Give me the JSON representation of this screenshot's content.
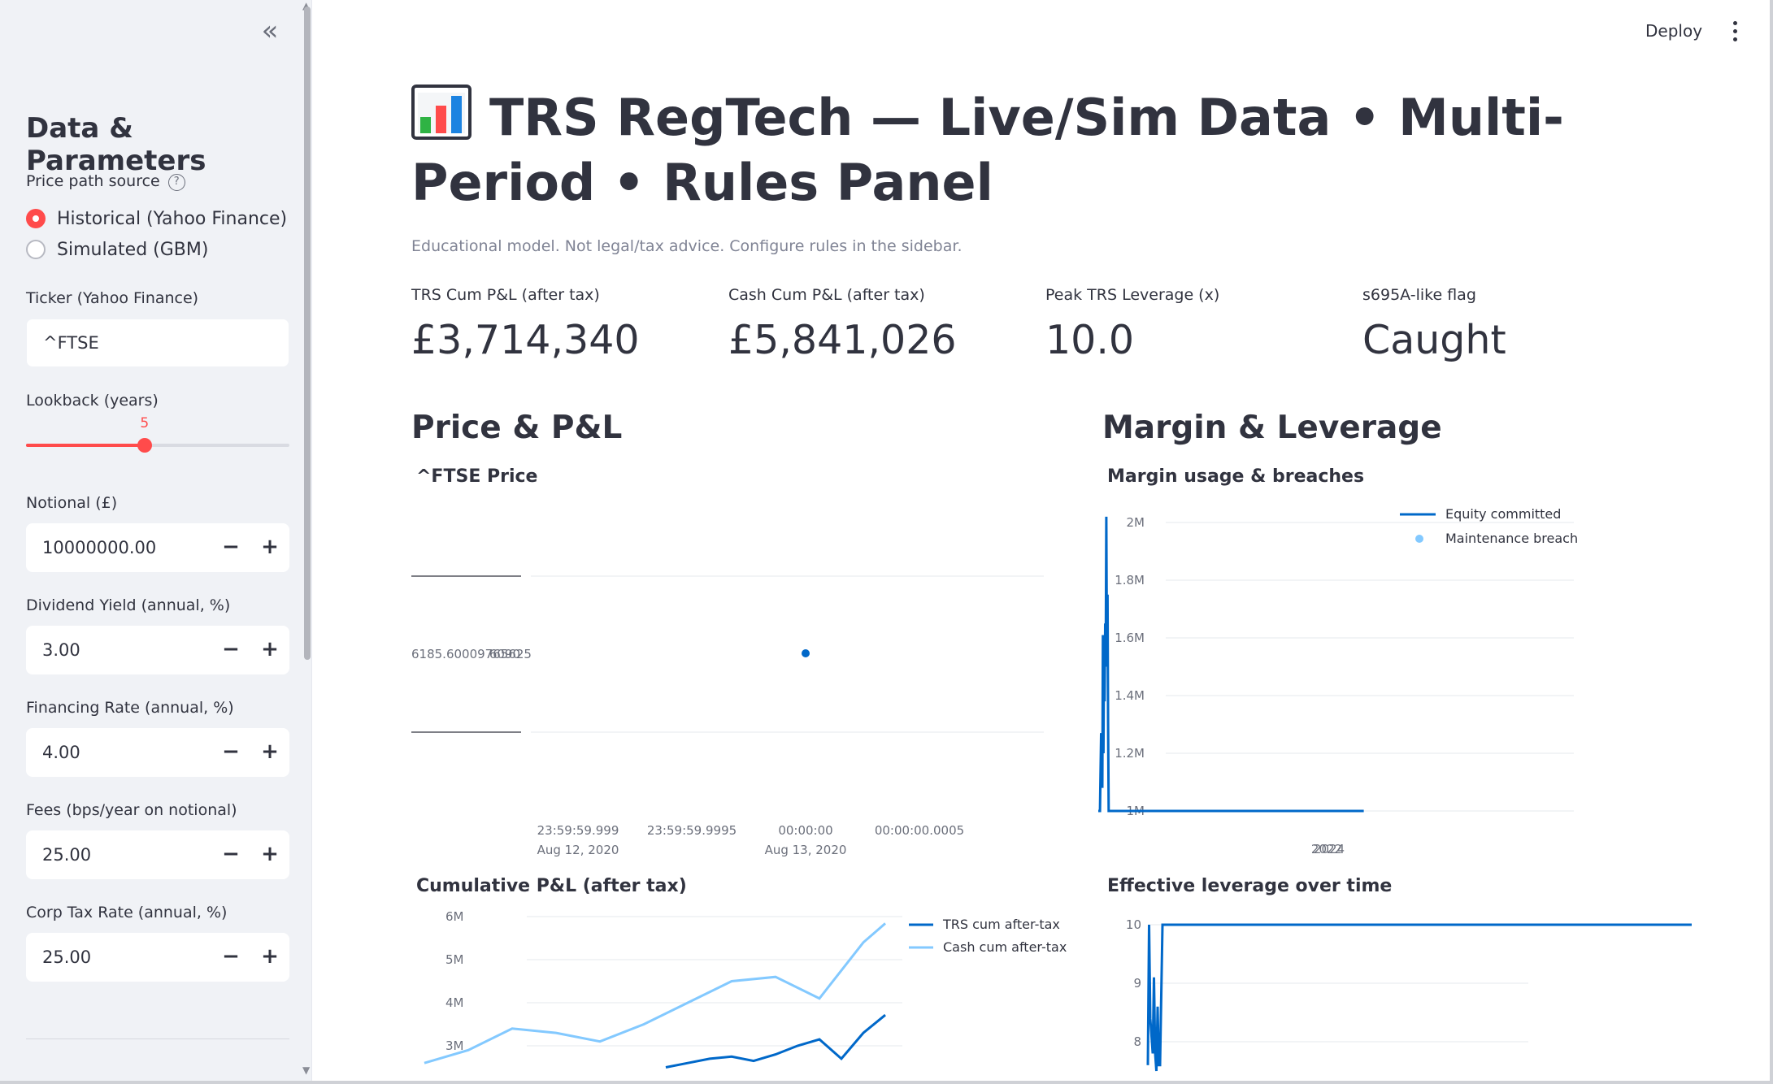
{
  "sidebar": {
    "collapse_glyph": "«",
    "title": "Data & Parameters",
    "price_source": {
      "label": "Price path source",
      "help": "?",
      "options": [
        "Historical (Yahoo Finance)",
        "Simulated (GBM)"
      ],
      "selected": 0
    },
    "ticker": {
      "label": "Ticker (Yahoo Finance)",
      "value": "^FTSE"
    },
    "lookback": {
      "label": "Lookback (years)",
      "value": "5",
      "fraction": 0.45
    },
    "notional": {
      "label": "Notional (£)",
      "value": "10000000.00"
    },
    "dividend_yield": {
      "label": "Dividend Yield (annual, %)",
      "value": "3.00"
    },
    "financing_rate": {
      "label": "Financing Rate (annual, %)",
      "value": "4.00"
    },
    "fees": {
      "label": "Fees (bps/year on notional)",
      "value": "25.00"
    },
    "corp_tax": {
      "label": "Corp Tax Rate (annual, %)",
      "value": "25.00"
    },
    "stepper": {
      "minus": "−",
      "plus": "+"
    }
  },
  "header": {
    "deploy_label": "Deploy"
  },
  "main": {
    "title": "TRS RegTech — Live/Sim Data • Multi-Period • Rules Panel",
    "title_icon": "bar-chart-icon",
    "caption": "Educational model. Not legal/tax advice. Configure rules in the sidebar.",
    "metrics": [
      {
        "label": "TRS Cum P&L (after tax)",
        "value": "£3,714,340"
      },
      {
        "label": "Cash Cum P&L (after tax)",
        "value": "£5,841,026"
      },
      {
        "label": "Peak TRS Leverage (x)",
        "value": "10.0"
      },
      {
        "label": "s695A-like flag",
        "value": "Caught"
      }
    ],
    "section_price": "Price & P&L",
    "section_margin": "Margin & Leverage"
  },
  "colors": {
    "accent": "#ff4b4b",
    "dark_blue": "#0068c9",
    "light_blue": "#83c9ff"
  },
  "chart_data": [
    {
      "type": "scatter",
      "title": "^FTSE Price",
      "y_ticks": [
        "6185.60009765625",
        "6090"
      ],
      "x_ticks": [
        {
          "line1": "23:59:59.999",
          "line2": "Aug 12, 2020"
        },
        {
          "line1": "23:59:59.9995",
          "line2": ""
        },
        {
          "line1": "00:00:00",
          "line2": "Aug 13, 2020"
        },
        {
          "line1": "00:00:00.0005",
          "line2": ""
        }
      ],
      "points": [
        {
          "x": "2020-08-13T00:00:00",
          "y": 6185.6
        }
      ],
      "grid": true
    },
    {
      "type": "line",
      "title": "Margin usage & breaches",
      "y_ticks": [
        "2M",
        "1.8M",
        "1.6M",
        "1.4M",
        "1.2M",
        "1M"
      ],
      "x_ticks": [
        "2022",
        "2024"
      ],
      "ylim": [
        1000000,
        2000000
      ],
      "legend": "top-right",
      "series": [
        {
          "name": "Equity committed",
          "color": "#0068c9",
          "x": [
            2020.0,
            2020.03,
            2020.05,
            2020.07,
            2020.08,
            2020.09,
            2020.1,
            2020.11,
            2020.12,
            2020.13,
            2020.14,
            2020.15,
            2020.16,
            2020.17,
            2020.18,
            2020.2,
            2020.3,
            2021.0,
            2022.0,
            2023.0,
            2024.0,
            2024.6
          ],
          "y": [
            1000000,
            1000000,
            1270000,
            1080000,
            1610000,
            1200000,
            1600000,
            1380000,
            1650000,
            1550000,
            2020000,
            1500000,
            1750000,
            1300000,
            1000000,
            1000000,
            1000000,
            1000000,
            1000000,
            1000000,
            1000000,
            1000000
          ]
        },
        {
          "name": "Maintenance breach",
          "color": "#83c9ff",
          "marker": "point",
          "x": [],
          "y": []
        }
      ]
    },
    {
      "type": "line",
      "title": "Cumulative P&L (after tax)",
      "y_ticks": [
        "6M",
        "5M",
        "4M",
        "3M"
      ],
      "legend": "top-right",
      "series": [
        {
          "name": "TRS cum after-tax",
          "color": "#0068c9",
          "x": [
            2023.0,
            2023.2,
            2023.4,
            2023.6,
            2023.8,
            2024.0,
            2024.2,
            2024.4,
            2024.6,
            2024.8,
            2025.0
          ],
          "y": [
            2500000,
            2600000,
            2700000,
            2750000,
            2650000,
            2800000,
            3000000,
            3150000,
            2700000,
            3300000,
            3714340
          ]
        },
        {
          "name": "Cash cum after-tax",
          "color": "#83c9ff",
          "x": [
            2020.8,
            2021.2,
            2021.6,
            2022.0,
            2022.4,
            2022.8,
            2023.2,
            2023.6,
            2024.0,
            2024.4,
            2024.8,
            2025.0
          ],
          "y": [
            2600000,
            2900000,
            3400000,
            3300000,
            3100000,
            3500000,
            4000000,
            4500000,
            4600000,
            4100000,
            5400000,
            5841026
          ]
        }
      ]
    },
    {
      "type": "line",
      "title": "Effective leverage over time",
      "y_ticks": [
        "10",
        "9",
        "8"
      ],
      "ylim": [
        7.5,
        10
      ],
      "series": [
        {
          "name": "",
          "color": "#0068c9",
          "x": [
            2020.0,
            2020.01,
            2020.02,
            2020.04,
            2020.05,
            2020.06,
            2020.07,
            2020.08,
            2020.09,
            2020.1,
            2020.12,
            2020.14,
            2020.2,
            2021.0,
            2022.0,
            2023.0,
            2024.0,
            2025.0
          ],
          "y": [
            7.6,
            10.0,
            8.4,
            7.8,
            9.1,
            7.8,
            7.5,
            8.6,
            7.6,
            7.6,
            10.0,
            10.0,
            10.0,
            10.0,
            10.0,
            10.0,
            10.0,
            10.0
          ]
        }
      ]
    }
  ]
}
